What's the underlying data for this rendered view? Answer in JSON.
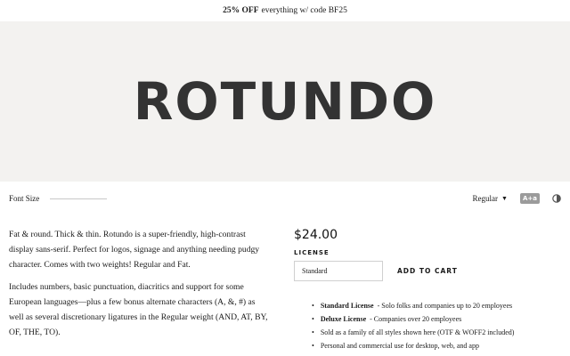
{
  "promo": {
    "bold": "25% OFF",
    "text": "everything w/ code BF25"
  },
  "hero": {
    "title": "ROTUNDO"
  },
  "controls": {
    "font_size_label": "Font Size",
    "weight": "Regular",
    "case_toggle": "A+a"
  },
  "description": {
    "p1": "Fat & round. Thick & thin. Rotundo is a super-friendly, high-contrast display sans-serif. Perfect for logos, signage and anything needing pudgy character. Comes with two weights! Regular and Fat.",
    "p2": "Includes numbers, basic punctuation, diacritics and support for some European languages—plus a few bonus alternate characters (A, &, #) as well as several discretionary ligatures in the Regular weight (AND, AT, BY, OF, THE, TO)."
  },
  "purchase": {
    "price": "$24.00",
    "license_label": "LICENSE",
    "license_value": "Standard",
    "add_to_cart": "ADD TO CART",
    "licenses": [
      {
        "title": "Standard License",
        "text": "- Solo folks and companies up to 20 employees"
      },
      {
        "title": "Deluxe License",
        "text": "- Companies over 20 employees"
      },
      {
        "title": "",
        "text": "Sold as a family of all styles shown here (OTF & WOFF2 included)"
      },
      {
        "title": "",
        "text": "Personal and commercial use for desktop, web, and app"
      }
    ]
  }
}
